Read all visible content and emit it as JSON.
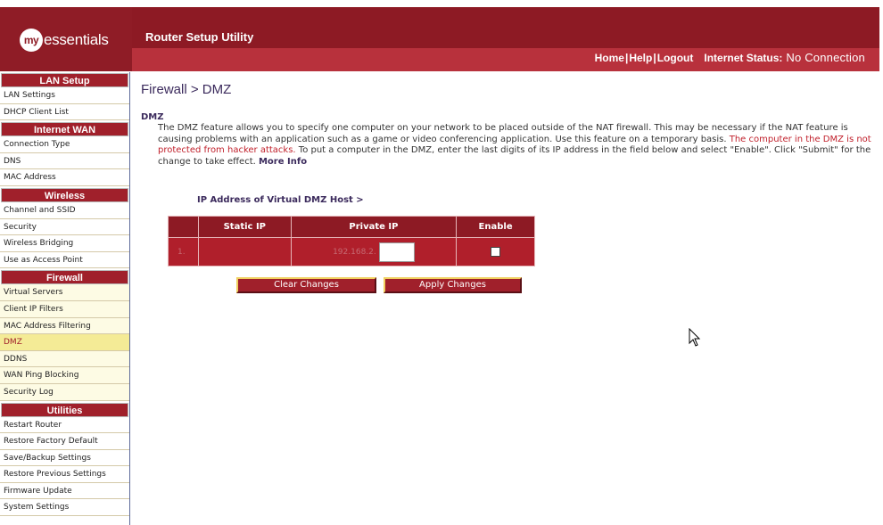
{
  "header": {
    "logo_prefix": "my",
    "logo_text": "essentials",
    "app_title": "Router Setup Utility",
    "links": {
      "home": "Home",
      "help": "Help",
      "logout": "Logout"
    },
    "status_label": "Internet Status:",
    "status_value": "No Connection"
  },
  "sidebar": {
    "sections": [
      {
        "title": "LAN Setup",
        "items": [
          "LAN Settings",
          "DHCP Client List"
        ]
      },
      {
        "title": "Internet WAN",
        "items": [
          "Connection Type",
          "DNS",
          "MAC Address"
        ]
      },
      {
        "title": "Wireless",
        "items": [
          "Channel and SSID",
          "Security",
          "Wireless Bridging",
          "Use as Access Point"
        ]
      },
      {
        "title": "Firewall",
        "items": [
          "Virtual Servers",
          "Client IP Filters",
          "MAC Address Filtering",
          "DMZ",
          "DDNS",
          "WAN Ping Blocking",
          "Security Log"
        ]
      },
      {
        "title": "Utilities",
        "items": [
          "Restart Router",
          "Restore Factory Default",
          "Save/Backup Settings",
          "Restore Previous Settings",
          "Firmware Update",
          "System Settings"
        ]
      }
    ],
    "active_item": "DMZ"
  },
  "main": {
    "page_title": "Firewall > DMZ",
    "section_label": "DMZ",
    "desc_part1": "The DMZ feature allows you to specify one computer on your network to be placed outside of the NAT firewall. This may be necessary if the NAT feature is causing problems with an application such as a game or video conferencing application. Use this feature on a temporary basis. ",
    "desc_warning": "The computer in the DMZ is not protected from hacker attacks.",
    "desc_part2": " To put a computer in the DMZ, enter the last digits of its IP address in the field below and select \"Enable\". Click \"Submit\" for the change to take effect. ",
    "more_info": "More Info",
    "vhost_label": "IP Address of Virtual DMZ Host >",
    "table": {
      "headers": [
        "",
        "Static IP",
        "Private IP",
        "Enable"
      ],
      "row": {
        "num": "1.",
        "static_ip": "",
        "private_ip_prefix": "192.168.2.",
        "private_ip_value": "",
        "enabled": false
      }
    },
    "clear_button": "Clear Changes",
    "apply_button": "Apply Changes"
  },
  "colors": {
    "brand_red": "#a0202b",
    "brand_dark": "#8d1a24",
    "highlight": "#f4eb96",
    "title_purple": "#3b2a5c"
  }
}
